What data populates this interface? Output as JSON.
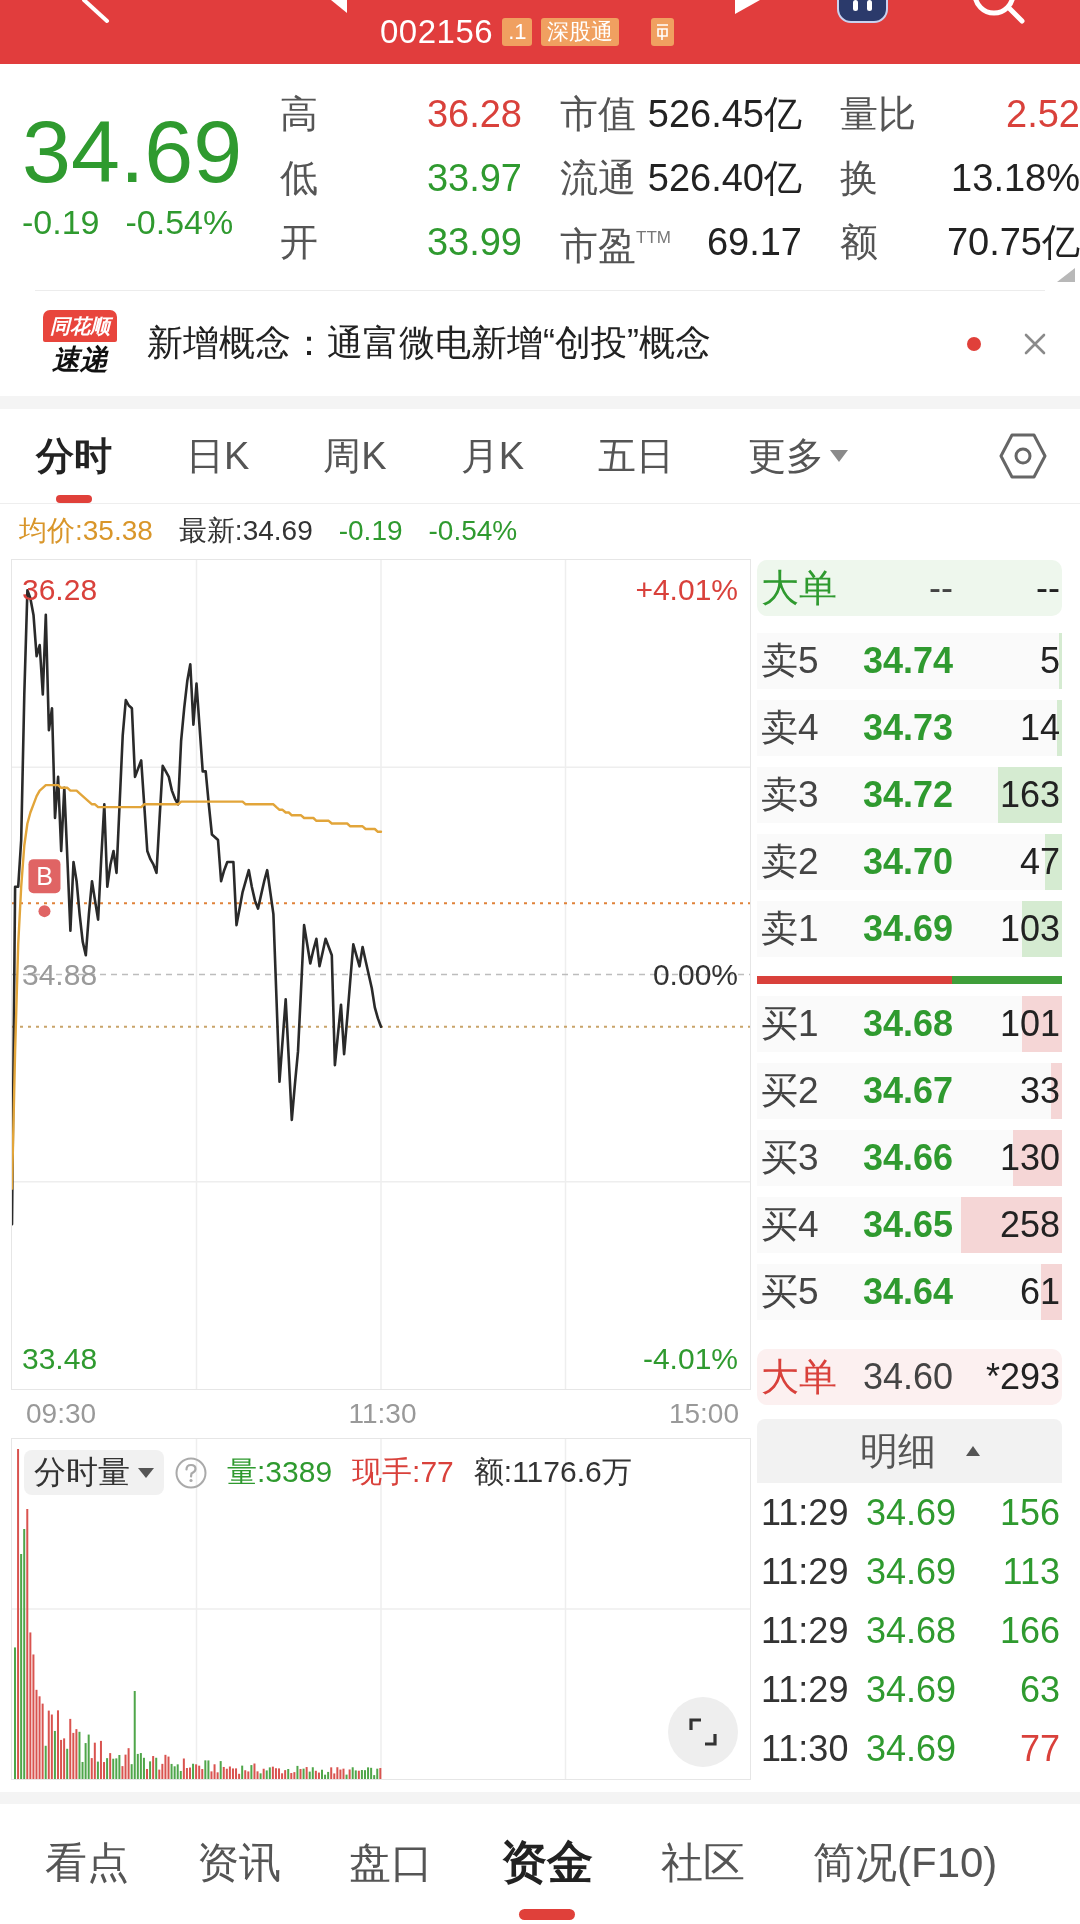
{
  "header": {
    "code": "002156",
    "badges": [
      ".1",
      "深股通"
    ]
  },
  "quote": {
    "price": "34.69",
    "change": "-0.19",
    "change_percent": "-0.54%",
    "color": "#2f9a2f",
    "stats": [
      {
        "label": "高",
        "value": "36.28",
        "color": "#d9413b"
      },
      {
        "label": "市值",
        "value": "526.45亿",
        "color": "#222222"
      },
      {
        "label": "量比",
        "value": "2.52",
        "color": "#d9413b"
      },
      {
        "label": "低",
        "value": "33.97",
        "color": "#2f9a2f"
      },
      {
        "label": "流通",
        "value": "526.40亿",
        "color": "#222222"
      },
      {
        "label": "换",
        "value": "13.18%",
        "color": "#222222"
      },
      {
        "label": "开",
        "value": "33.99",
        "color": "#2f9a2f"
      },
      {
        "label": "市盈$^{TTM}$",
        "value": "69.17",
        "color": "#222222"
      },
      {
        "label": "额",
        "value": "70.75亿",
        "color": "#222222"
      }
    ]
  },
  "news": {
    "logo_badge": "同花顺",
    "logo_text": "速递",
    "headline": "新增概念：通富微电新增“创投”概念",
    "unread": true
  },
  "tabs": [
    {
      "label": "分时",
      "selected": true,
      "dropdown": false
    },
    {
      "label": "日K",
      "selected": false,
      "dropdown": false
    },
    {
      "label": "周K",
      "selected": false,
      "dropdown": false
    },
    {
      "label": "月K",
      "selected": false,
      "dropdown": false
    },
    {
      "label": "五日",
      "selected": false,
      "dropdown": false
    },
    {
      "label": "更多",
      "selected": false,
      "dropdown": true
    }
  ],
  "info": [
    {
      "text": "均价:35.38",
      "color": "#d9962a"
    },
    {
      "text": "最新:34.69",
      "color": "#333333"
    },
    {
      "text": "-0.19",
      "color": "#2f9a2f"
    },
    {
      "text": "-0.54%",
      "color": "#2f9a2f"
    }
  ],
  "chart": {
    "right_labels": [
      "+4.01%",
      "0.00%",
      "-4.01%"
    ],
    "chart_data": {
      "type": "line",
      "categories": [
        null,
        null,
        null,
        null,
        null,
        null,
        null,
        null,
        null,
        null,
        null,
        null,
        null,
        null,
        null,
        null,
        null,
        null,
        null,
        null,
        null,
        null,
        null,
        null,
        null,
        null,
        null,
        null,
        null,
        null,
        null,
        null,
        null,
        null,
        null,
        null,
        null,
        null,
        null,
        null,
        null,
        null,
        null,
        null,
        null,
        null,
        null,
        null,
        null,
        null,
        null,
        null,
        null,
        null,
        null,
        null,
        null,
        null,
        null,
        null,
        null,
        null,
        null,
        null,
        null,
        null,
        null,
        null,
        null,
        null,
        null,
        null,
        null,
        null,
        null,
        null,
        null,
        null,
        null,
        null,
        null,
        null,
        null,
        null,
        null,
        null,
        null,
        null,
        null,
        null,
        null,
        null,
        null,
        null,
        null,
        null,
        null,
        null,
        null,
        null,
        null,
        null,
        null,
        null,
        null,
        null,
        null,
        null,
        null,
        null,
        null,
        null,
        null,
        null,
        null,
        null,
        null,
        null,
        null,
        null,
        null,
        null,
        null,
        null,
        null,
        null,
        null,
        null,
        null,
        null,
        null,
        null,
        null,
        null,
        null,
        null,
        null,
        null,
        null,
        null,
        null,
        null,
        null,
        null,
        null,
        null,
        null,
        null,
        null,
        null,
        null,
        null,
        null,
        null,
        null,
        null,
        null,
        null,
        null,
        null,
        null,
        null,
        null,
        null,
        null,
        null,
        null,
        null,
        null,
        null,
        null,
        null,
        null,
        null,
        null,
        null,
        null,
        null,
        null,
        null,
        null,
        null,
        null,
        null,
        null,
        null,
        null,
        null,
        null,
        null,
        null,
        null,
        null,
        null,
        null,
        null,
        null,
        null,
        null,
        null,
        null,
        null,
        null,
        null,
        null,
        null,
        null,
        null,
        null,
        null,
        null,
        null,
        null,
        null,
        null,
        null,
        null,
        null,
        null,
        null,
        null,
        null,
        null,
        null,
        null,
        null,
        null,
        null,
        null,
        null,
        null,
        null,
        null,
        null,
        null,
        null,
        null,
        null,
        null,
        null,
        null
      ],
      "series": [
        {
          "color": "#2a2a2a",
          "values": [
            33.97,
            35.2,
            35.2,
            35.37,
            35.9,
            36.28,
            36.25,
            36.19,
            36.04,
            36.08,
            35.9,
            36.19,
            35.77,
            35.85,
            35.45,
            35.6,
            35.33,
            35.56,
            35.3,
            35.04,
            35.29,
            35.22,
            35.1,
            35.0,
            34.95,
            35.1,
            35.22,
            35.15,
            35.08,
            35.3,
            35.5,
            35.2,
            35.28,
            35.33,
            35.25,
            35.5,
            35.75,
            35.88,
            35.86,
            35.85,
            35.6,
            35.63,
            35.66,
            35.5,
            35.33,
            35.3,
            35.28,
            35.25,
            35.45,
            35.64,
            35.62,
            35.6,
            35.55,
            35.52,
            35.5,
            35.73,
            35.85,
            35.95,
            36.01,
            35.79,
            35.94,
            35.78,
            35.62,
            35.62,
            35.5,
            35.39,
            35.38,
            35.37,
            35.22,
            35.26,
            35.29,
            35.29,
            35.29,
            35.06,
            35.12,
            35.18,
            35.22,
            35.26,
            35.2,
            35.15,
            35.12,
            35.17,
            35.22,
            35.26,
            35.18,
            35.1,
            34.8,
            34.49,
            34.64,
            34.79,
            34.57,
            34.35,
            34.48,
            34.6,
            34.83,
            35.06,
            34.99,
            34.92,
            34.97,
            35.01,
            34.91,
            34.96,
            35.01,
            34.98,
            34.95,
            34.55,
            34.66,
            34.77,
            34.59,
            34.72,
            34.86,
            34.99,
            34.95,
            34.91,
            34.98,
            34.93,
            34.88,
            34.83,
            34.76,
            34.72,
            34.69,
            null,
            null,
            null,
            null,
            null,
            null,
            null,
            null,
            null,
            null,
            null,
            null,
            null,
            null,
            null,
            null,
            null,
            null,
            null,
            null,
            null,
            null,
            null,
            null,
            null,
            null,
            null,
            null,
            null,
            null,
            null,
            null,
            null,
            null,
            null,
            null,
            null,
            null,
            null,
            null,
            null,
            null,
            null,
            null,
            null,
            null,
            null,
            null,
            null,
            null,
            null,
            null,
            null,
            null,
            null,
            null,
            null,
            null,
            null,
            null,
            null,
            null,
            null,
            null,
            null,
            null,
            null,
            null,
            null,
            null,
            null,
            null,
            null,
            null,
            null,
            null,
            null,
            null,
            null,
            null,
            null,
            null,
            null,
            null,
            null,
            null,
            null,
            null,
            null,
            null,
            null,
            null,
            null,
            null,
            null,
            null,
            null,
            null,
            null,
            null,
            null,
            null,
            null,
            null,
            null,
            null,
            null,
            null,
            null,
            null,
            null,
            null,
            null,
            null,
            null,
            null,
            null,
            null,
            null,
            null
          ]
        },
        {
          "color": "#e2a53a",
          "values": [
            34.1,
            34.6,
            34.99,
            35.2,
            35.35,
            35.43,
            35.47,
            35.5,
            35.53,
            35.55,
            35.56,
            35.57,
            35.57,
            35.57,
            35.57,
            35.57,
            35.56,
            35.56,
            35.56,
            35.55,
            35.55,
            35.55,
            35.54,
            35.53,
            35.52,
            35.51,
            35.5,
            35.5,
            35.49,
            35.49,
            35.49,
            35.49,
            35.49,
            35.49,
            35.49,
            35.49,
            35.49,
            35.49,
            35.49,
            35.49,
            35.49,
            35.49,
            35.49,
            35.5,
            35.5,
            35.5,
            35.5,
            35.5,
            35.5,
            35.5,
            35.5,
            35.5,
            35.5,
            35.5,
            35.5,
            35.51,
            35.51,
            35.51,
            35.51,
            35.51,
            35.51,
            35.51,
            35.51,
            35.51,
            35.51,
            35.51,
            35.51,
            35.51,
            35.51,
            35.51,
            35.51,
            35.51,
            35.51,
            35.51,
            35.51,
            35.51,
            35.5,
            35.5,
            35.5,
            35.5,
            35.5,
            35.5,
            35.5,
            35.5,
            35.5,
            35.5,
            35.49,
            35.48,
            35.48,
            35.47,
            35.47,
            35.46,
            35.46,
            35.46,
            35.46,
            35.45,
            35.45,
            35.45,
            35.45,
            35.44,
            35.44,
            35.44,
            35.44,
            35.44,
            35.43,
            35.43,
            35.43,
            35.43,
            35.43,
            35.43,
            35.42,
            35.42,
            35.42,
            35.42,
            35.42,
            35.41,
            35.41,
            35.41,
            35.41,
            35.4,
            35.4,
            null,
            null,
            null,
            null,
            null,
            null,
            null,
            null,
            null,
            null,
            null,
            null,
            null,
            null,
            null,
            null,
            null,
            null,
            null,
            null,
            null,
            null,
            null,
            null,
            null,
            null,
            null,
            null,
            null,
            null,
            null,
            null,
            null,
            null,
            null,
            null,
            null,
            null,
            null,
            null,
            null,
            null,
            null,
            null,
            null,
            null,
            null,
            null,
            null,
            null,
            null,
            null,
            null,
            null,
            null,
            null,
            null,
            null,
            null,
            null,
            null,
            null,
            null,
            null,
            null,
            null,
            null,
            null,
            null,
            null,
            null,
            null,
            null,
            null,
            null,
            null,
            null,
            null,
            null,
            null,
            null,
            null,
            null,
            null,
            null,
            null,
            null,
            null,
            null,
            null,
            null,
            null,
            null,
            null,
            null,
            null,
            null,
            null,
            null,
            null,
            null,
            null,
            null,
            null,
            null,
            null,
            null,
            null,
            null,
            null,
            null,
            null,
            null,
            null,
            null,
            null,
            null,
            null,
            null,
            null
          ]
        }
      ],
      "ylim": [
        33.37,
        36.39
      ],
      "yticks": [
        {
          "value": 36.28,
          "label": "36.28"
        },
        {
          "value": 34.88,
          "label": "34.88"
        },
        {
          "value": 33.48,
          "label": "33.48"
        }
      ],
      "ref_lines": [
        {
          "axis": "y",
          "value": 34.88
        },
        {
          "axis": "y",
          "value": 35.14
        },
        {
          "axis": "y",
          "value": 34.69
        }
      ],
      "annotations": [
        "B"
      ]
    },
    "time_labels": [
      "09:30",
      "11:30",
      "15:00"
    ]
  },
  "volume": {
    "selector": "分时量",
    "stats": [
      {
        "text": "量:3389",
        "color": "#2f9a2f"
      },
      {
        "text": "现手:77",
        "color": "#d9413b"
      },
      {
        "text": "额:1176.6万",
        "color": "#333333"
      }
    ]
  },
  "order_book": {
    "top_large_order": {
      "kind": "sell",
      "label": "大单",
      "price": "--",
      "volume": "--"
    },
    "levels": [
      {
        "kind": "sell",
        "label": "卖5",
        "price": "34.74",
        "volume": "5",
        "level": 0.01
      },
      {
        "kind": "sell",
        "label": "卖4",
        "price": "34.73",
        "volume": "14",
        "level": 0.015
      },
      {
        "kind": "sell",
        "label": "卖3",
        "price": "34.72",
        "volume": "163",
        "level": 0.21
      },
      {
        "kind": "sell",
        "label": "卖2",
        "price": "34.70",
        "volume": "47",
        "level": 0.055
      },
      {
        "kind": "sell",
        "label": "卖1",
        "price": "34.69",
        "volume": "103",
        "level": 0.13
      },
      {
        "kind": "buy",
        "label": "买1",
        "price": "34.68",
        "volume": "101",
        "level": 0.13
      },
      {
        "kind": "buy",
        "label": "买2",
        "price": "34.67",
        "volume": "33",
        "level": 0.036
      },
      {
        "kind": "buy",
        "label": "买3",
        "price": "34.66",
        "volume": "130",
        "level": 0.16
      },
      {
        "kind": "buy",
        "label": "买4",
        "price": "34.65",
        "volume": "258",
        "level": 0.33
      },
      {
        "kind": "buy",
        "label": "买5",
        "price": "34.64",
        "volume": "61",
        "level": 0.07
      }
    ],
    "ratio": {
      "level": 0.64
    },
    "bottom_large_order": {
      "kind": "buy",
      "label": "大单",
      "price": "34.60",
      "volume": "*293"
    }
  },
  "trades": {
    "title": "明细",
    "rows": [
      {
        "time": "11:29",
        "price": "34.69",
        "volume": "156",
        "color": "#2f9a2f"
      },
      {
        "time": "11:29",
        "price": "34.69",
        "volume": "113",
        "color": "#2f9a2f"
      },
      {
        "time": "11:29",
        "price": "34.68",
        "volume": "166",
        "color": "#2f9a2f"
      },
      {
        "time": "11:29",
        "price": "34.69",
        "volume": "63",
        "color": "#2f9a2f"
      },
      {
        "time": "11:30",
        "price": "34.69",
        "volume": "77",
        "color": "#d9413b"
      }
    ]
  },
  "bottom_tabs": [
    {
      "label": "看点",
      "selected": false
    },
    {
      "label": "资讯",
      "selected": false
    },
    {
      "label": "盘口",
      "selected": false
    },
    {
      "label": "资金",
      "selected": true
    },
    {
      "label": "社区",
      "selected": false
    },
    {
      "label": "简况(F10)",
      "selected": false
    }
  ]
}
